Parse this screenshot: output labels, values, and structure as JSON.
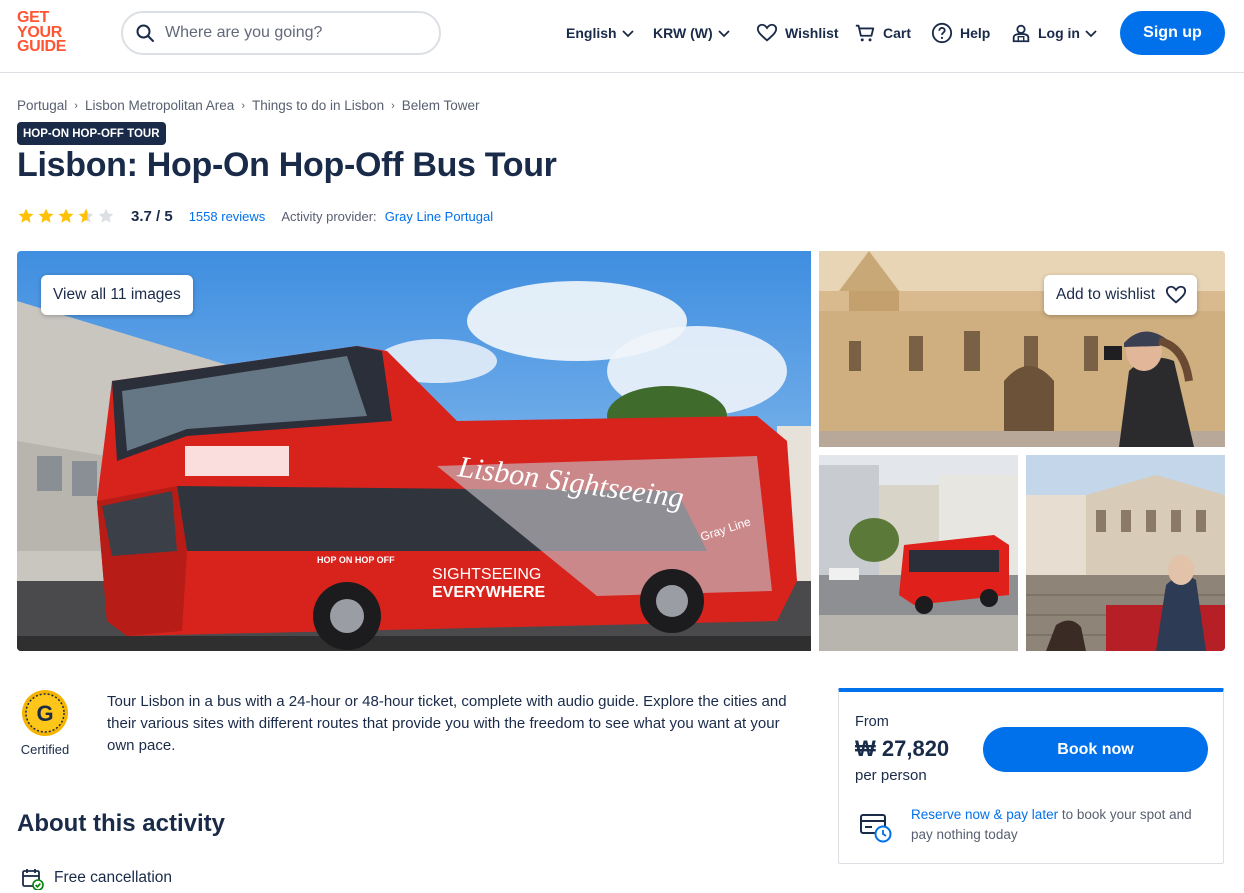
{
  "header": {
    "logo_lines": [
      "GET",
      "YOUR",
      "GUIDE"
    ],
    "search_placeholder": "Where are you going?",
    "language": "English",
    "currency": "KRW (W)",
    "wishlist": "Wishlist",
    "cart": "Cart",
    "help": "Help",
    "login": "Log in",
    "signup": "Sign up"
  },
  "breadcrumb": [
    "Portugal",
    "Lisbon Metropolitan Area",
    "Things to do in Lisbon",
    "Belem Tower"
  ],
  "badge": "HOP-ON HOP-OFF TOUR",
  "title": "Lisbon: Hop-On Hop-Off Bus Tour",
  "rating": {
    "stars": 3.7,
    "value_text": "3.7 / 5",
    "reviews_text": "1558 reviews",
    "provider_label": "Activity provider:",
    "provider": "Gray Line Portugal"
  },
  "gallery": {
    "view_all": "View all 11 images",
    "add_wishlist": "Add to wishlist",
    "bus_text_1": "Lisbon Sightseeing",
    "bus_text_2": "SIGHTSEEING",
    "bus_text_3": "EVERYWHERE",
    "bus_text_4": "HOP ON HOP OFF",
    "bus_text_5": "Gray Line"
  },
  "certified": {
    "letter": "G",
    "label": "Certified"
  },
  "description": "Tour Lisbon in a bus with a 24-hour or 48-hour ticket, complete with audio guide. Explore the cities and their various sites with different routes that provide you with the freedom to see what you want at your own pace.",
  "about": {
    "heading": "About this activity",
    "free_cancellation": "Free cancellation"
  },
  "booking": {
    "from": "From",
    "price": "₩ 27,820",
    "per_person": "per person",
    "book_now": "Book now",
    "reserve_link": "Reserve now & pay later",
    "reserve_rest": " to book your spot and pay nothing today"
  },
  "colors": {
    "brand": "#ff5533",
    "primary": "#0071eb",
    "text": "#1a2b49",
    "star": "#ffc107"
  }
}
